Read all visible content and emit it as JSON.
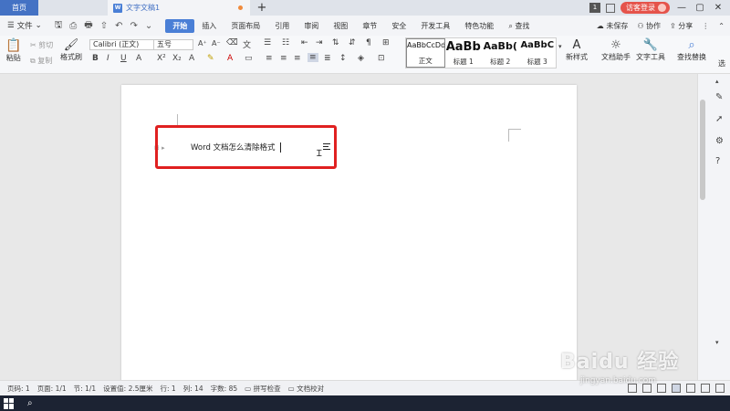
{
  "titlebar": {
    "home_tab": "首页",
    "doc_tab": "文字文稿1",
    "doc_icon": "W",
    "plus": "+",
    "badge": "1",
    "visitor_login": "访客登录",
    "minimize": "—",
    "close": "✕"
  },
  "menubar": {
    "file_label": "文件",
    "tabs": [
      "开始",
      "插入",
      "页面布局",
      "引用",
      "审阅",
      "视图",
      "章节",
      "安全",
      "开发工具",
      "特色功能"
    ],
    "search_label": "查找",
    "unsaved": "未保存",
    "collab": "协作",
    "share": "分享"
  },
  "ribbon": {
    "paste": "粘贴",
    "cut": "剪切",
    "copy": "复制",
    "format_painter": "格式刷",
    "font_name": "Calibri (正文)",
    "font_size": "五号",
    "styles": [
      {
        "sample": "AaBbCcDd",
        "name": "正文"
      },
      {
        "sample": "AaBb",
        "name": "标题 1"
      },
      {
        "sample": "AaBb(",
        "name": "标题 2"
      },
      {
        "sample": "AaBbC",
        "name": "标题 3"
      }
    ],
    "new_style": "新样式",
    "doc_assistant": "文档助手",
    "text_tools": "文字工具",
    "find_replace": "查找替换",
    "select": "选"
  },
  "document": {
    "text": "Word 文档怎么清除格式"
  },
  "statusbar": {
    "page_num": "页码: 1",
    "pages": "页面: 1/1",
    "section": "节: 1/1",
    "position": "设置值: 2.5厘米",
    "row": "行: 1",
    "col": "列: 14",
    "word_count": "字数: 85",
    "spell_check": "拼写检查",
    "doc_proof": "文档校对"
  },
  "watermark": {
    "brand": "Baidu 经验",
    "url": "jingyan.baidu.com"
  },
  "colors": {
    "accent": "#4a7fd6",
    "highlight_box": "#e02020",
    "login_button": "#e5534b"
  }
}
